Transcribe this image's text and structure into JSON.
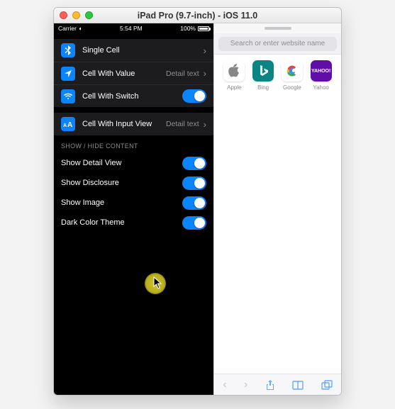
{
  "window": {
    "title": "iPad Pro (9.7-inch) - iOS 11.0"
  },
  "statusbar": {
    "carrier": "Carrier",
    "time": "5:54 PM",
    "battery": "100%"
  },
  "cells_group1": [
    {
      "label": "Single Cell",
      "icon_name": "bluetooth-icon",
      "icon_bg": "#0a84ff",
      "detail": "",
      "has_switch": false,
      "disclosure": true
    },
    {
      "label": "Cell With Value",
      "icon_name": "location-icon",
      "icon_bg": "#0a84ff",
      "detail": "Detail text",
      "has_switch": false,
      "disclosure": true
    },
    {
      "label": "Cell With Switch",
      "icon_name": "wifi-icon",
      "icon_bg": "#0a84ff",
      "detail": "",
      "has_switch": true,
      "disclosure": false
    }
  ],
  "cells_group2": [
    {
      "label": "Cell With Input View",
      "icon_name": "text-size-icon",
      "icon_bg": "#0a84ff",
      "detail": "Detail text",
      "has_switch": false,
      "disclosure": true
    }
  ],
  "section_header": "Show / Hide Content",
  "toggles": [
    {
      "label": "Show Detail View",
      "on": true
    },
    {
      "label": "Show Disclosure",
      "on": true
    },
    {
      "label": "Show Image",
      "on": true
    },
    {
      "label": "Dark Color Theme",
      "on": true
    }
  ],
  "safari": {
    "placeholder": "Search or enter website name",
    "favorites": [
      {
        "label": "Apple",
        "bg": "#ffffff",
        "fg": "#888888"
      },
      {
        "label": "Bing",
        "bg": "#0b8484",
        "fg": "#ffffff"
      },
      {
        "label": "Google",
        "bg": "#ffffff",
        "fg": "#4285f4"
      },
      {
        "label": "Yahoo",
        "bg": "#5f0ea8",
        "fg": "#ffffff"
      }
    ]
  },
  "colors": {
    "accent": "#0a84ff",
    "dark_cell": "#1c1c1e"
  }
}
